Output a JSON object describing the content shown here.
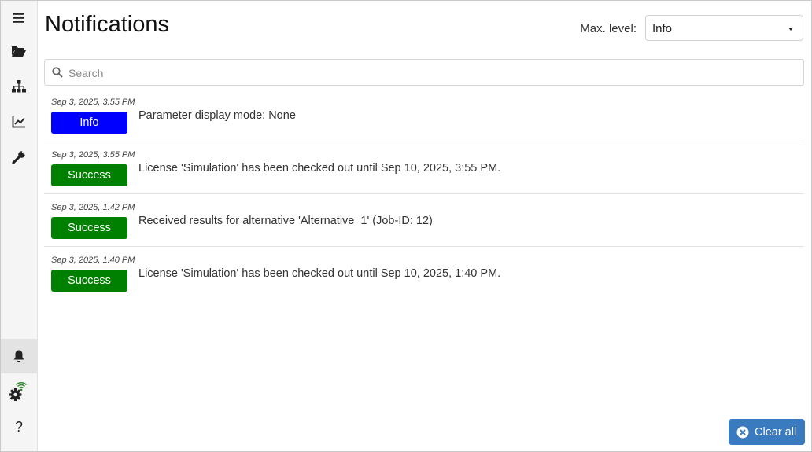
{
  "sidebar": {
    "items": [
      {
        "icon": "hamburger-menu-icon"
      },
      {
        "icon": "folder-open-icon"
      },
      {
        "icon": "sitemap-icon"
      },
      {
        "icon": "chart-line-icon"
      },
      {
        "icon": "wrench-icon"
      },
      {
        "icon": "bell-icon",
        "active": true
      },
      {
        "icon": "gear-wifi-icon"
      },
      {
        "icon": "help-icon",
        "label": "?"
      }
    ]
  },
  "header": {
    "title": "Notifications",
    "max_level_label": "Max. level:",
    "max_level_value": "Info"
  },
  "search": {
    "placeholder": "Search"
  },
  "notifications": [
    {
      "timestamp": "Sep 3, 2025, 3:55 PM",
      "level": "Info",
      "message": "Parameter display mode: None"
    },
    {
      "timestamp": "Sep 3, 2025, 3:55 PM",
      "level": "Success",
      "message": "License 'Simulation' has been checked out until Sep 10, 2025, 3:55 PM."
    },
    {
      "timestamp": "Sep 3, 2025, 1:42 PM",
      "level": "Success",
      "message": "Received results for alternative 'Alternative_1' (Job-ID: 12)"
    },
    {
      "timestamp": "Sep 3, 2025, 1:40 PM",
      "level": "Success",
      "message": "License 'Simulation' has been checked out until Sep 10, 2025, 1:40 PM."
    }
  ],
  "colors": {
    "info": "#0000ff",
    "success": "#008000",
    "primary_button": "#3a7bbf",
    "wifi_accent": "#2e8b2e"
  },
  "footer": {
    "clear_all_label": "Clear all"
  }
}
